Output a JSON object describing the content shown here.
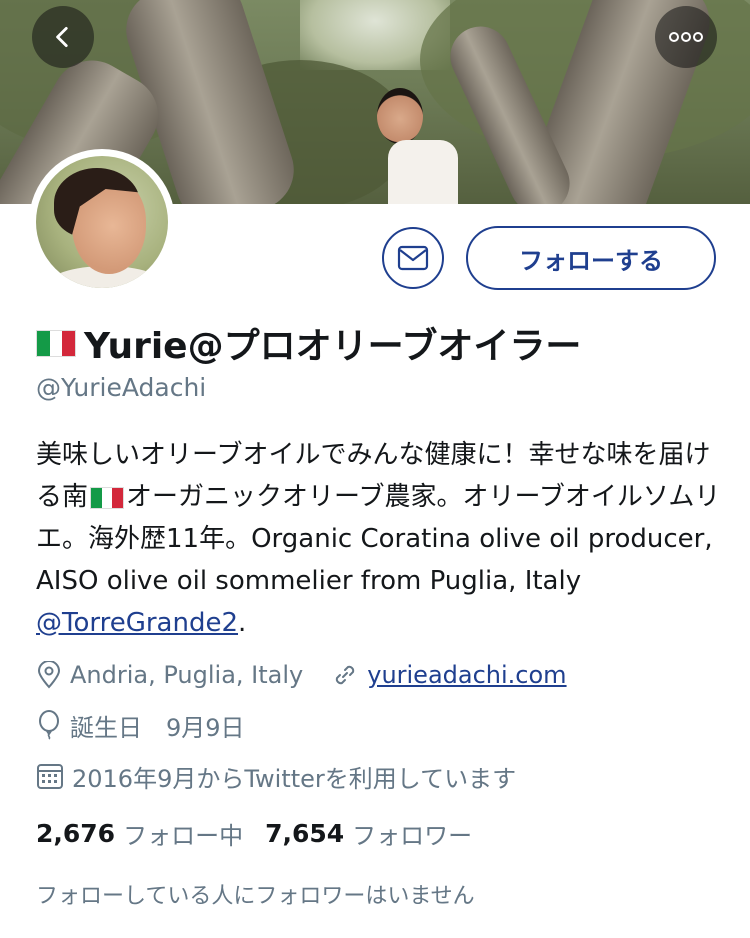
{
  "header": {
    "back_icon": "chevron-left-icon",
    "more_icon": "more-dots-icon"
  },
  "actions": {
    "message_icon": "mail-icon",
    "follow_label": "フォローする"
  },
  "profile": {
    "display_name": "Yurie@プロオリーブオイラー",
    "flag_icon": "italy-flag-icon",
    "handle": "@YurieAdachi",
    "bio_part1": "美味しいオリーブオイルでみんな健康に！幸せな味を届ける南",
    "bio_part2": "オーガニックオリーブ農家。オリーブオイルソムリエ。海外歴11年。Organic Coratina olive oil producer, AISO olive oil sommelier from Puglia, Italy ",
    "bio_mention": "@TorreGrande2",
    "bio_end": ".",
    "location": "Andria, Puglia, Italy",
    "website": "yurieadachi.com",
    "birthday": "誕生日　9月9日",
    "joined": "2016年9月からTwitterを利用しています",
    "following_count": "2,676",
    "following_label": "フォロー中",
    "followers_count": "7,654",
    "followers_label": "フォロワー",
    "followed_by_note": "フォローしている人にフォロワーはいません"
  },
  "colors": {
    "accent": "#1f3f8f",
    "secondary_text": "#657786"
  }
}
